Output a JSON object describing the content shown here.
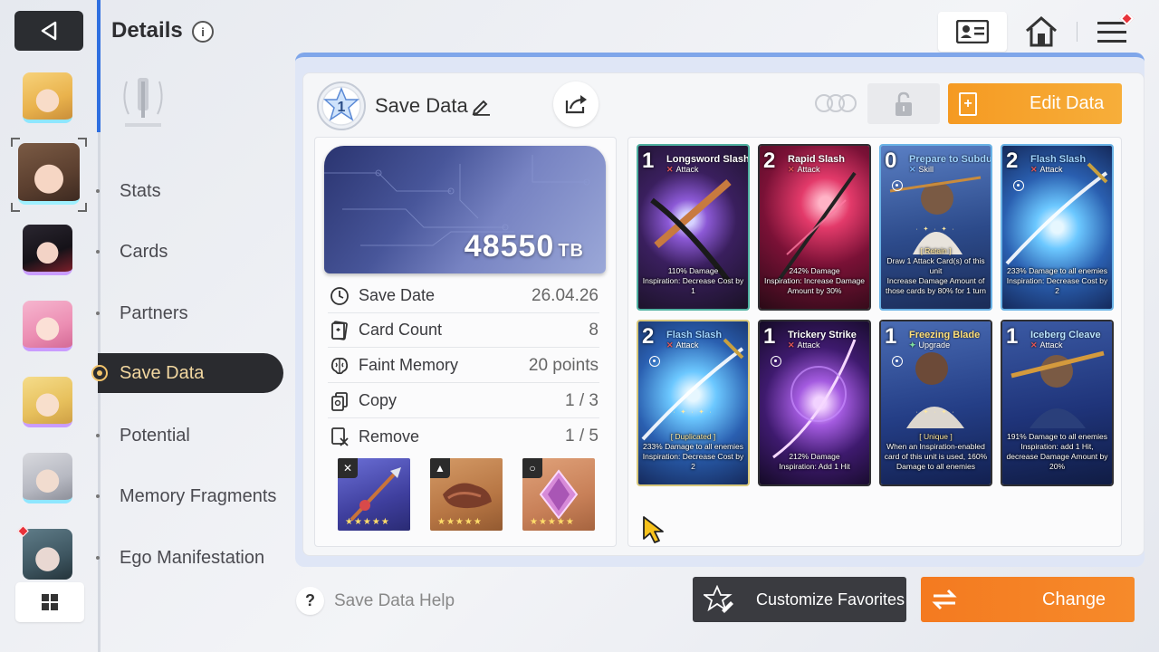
{
  "header": {
    "title": "Details",
    "info_icon": "i"
  },
  "nav": {
    "items": [
      {
        "label": "Stats",
        "active": false
      },
      {
        "label": "Cards",
        "active": false
      },
      {
        "label": "Partners",
        "active": false
      },
      {
        "label": "Save Data",
        "active": true
      },
      {
        "label": "Potential",
        "active": false
      },
      {
        "label": "Memory Fragments",
        "active": false
      },
      {
        "label": "Ego Manifestation",
        "active": false
      }
    ]
  },
  "save_data": {
    "rank": "1",
    "title": "Save Data",
    "capacity": "48550",
    "capacity_unit": "TB",
    "rows": [
      {
        "icon": "clock-icon",
        "label": "Save Date",
        "value": "26.04.26"
      },
      {
        "icon": "card-count-icon",
        "label": "Card Count",
        "value": "8"
      },
      {
        "icon": "brain-icon",
        "label": "Faint Memory",
        "value": "20 points"
      },
      {
        "icon": "copy-icon",
        "label": "Copy",
        "value": "1 / 3"
      },
      {
        "icon": "remove-icon",
        "label": "Remove",
        "value": "1 / 5"
      }
    ],
    "equipment": [
      {
        "type": "weapon",
        "stars": "★★★★★"
      },
      {
        "type": "armor",
        "stars": "★★★★★"
      },
      {
        "type": "ring",
        "stars": "★★★★★"
      }
    ]
  },
  "toolbar": {
    "edit_label": "Edit Data",
    "edit_icon": "+"
  },
  "cards": [
    {
      "cost": "1",
      "name": "Longsword Slash",
      "type": "Attack",
      "desc": "110% Damage\nInspiration: Decrease Cost by 1",
      "tag": ""
    },
    {
      "cost": "2",
      "name": "Rapid Slash",
      "type": "Attack",
      "desc": "242% Damage\nInspiration: Increase Damage Amount by 30%",
      "tag": ""
    },
    {
      "cost": "0",
      "name": "Prepare to Subdue",
      "type": "Skill",
      "desc": "Draw 1 Attack Card(s) of this unit\nIncrease Damage Amount of those cards by 80% for 1 turn",
      "tag": "[ Retain ]"
    },
    {
      "cost": "2",
      "name": "Flash Slash",
      "type": "Attack",
      "desc": "233% Damage to all enemies\nInspiration: Decrease Cost by 2",
      "tag": ""
    },
    {
      "cost": "2",
      "name": "Flash Slash",
      "type": "Attack",
      "desc": "233% Damage to all enemies\nInspiration: Decrease Cost by 2",
      "tag": "[ Duplicated ]"
    },
    {
      "cost": "1",
      "name": "Trickery Strike",
      "type": "Attack",
      "desc": "212% Damage\nInspiration: Add 1 Hit",
      "tag": ""
    },
    {
      "cost": "1",
      "name": "Freezing Blade",
      "type": "Upgrade",
      "desc": "When an Inspiration-enabled card of this unit is used, 160% Damage to all enemies",
      "tag": "[ Unique ]"
    },
    {
      "cost": "1",
      "name": "Iceberg Cleave",
      "type": "Attack",
      "desc": "191% Damage to all enemies\nInspiration: add 1 Hit, decrease Damage Amount by 20%",
      "tag": ""
    }
  ],
  "bottom": {
    "help_label": "Save Data Help",
    "help_icon": "?",
    "favorites_label": "Customize Favorites",
    "change_label": "Change"
  },
  "colors": {
    "accent_orange": "#f59a22",
    "nav_active_bg": "#2a2b2f",
    "nav_active_text": "#f2d7a0",
    "panel_accent": "#7fa6ea"
  }
}
